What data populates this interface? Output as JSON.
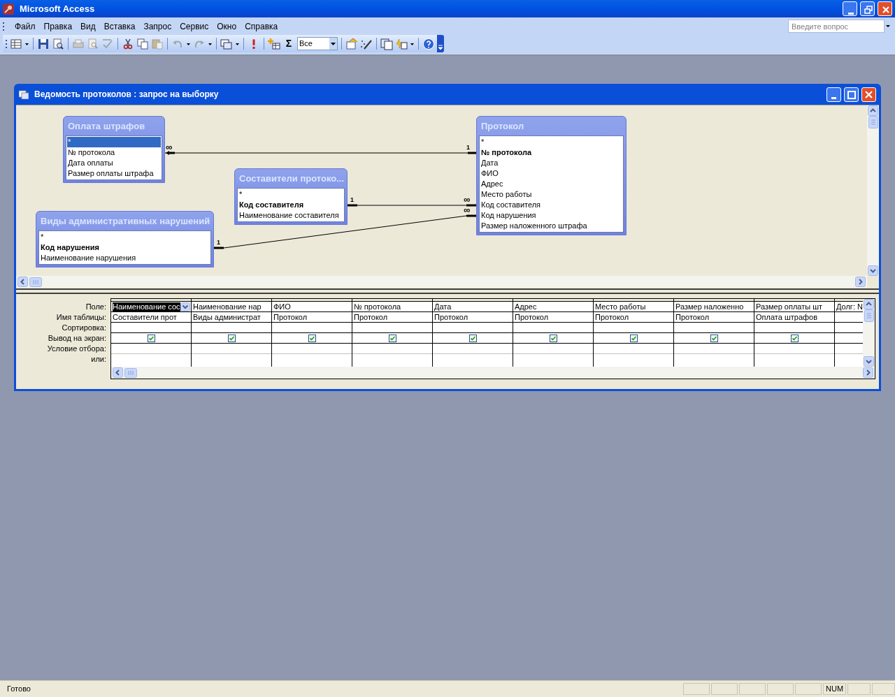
{
  "window": {
    "title": "Microsoft Access"
  },
  "menu": [
    "Файл",
    "Правка",
    "Вид",
    "Вставка",
    "Запрос",
    "Сервис",
    "Окно",
    "Справка"
  ],
  "help_box": {
    "placeholder": "Введите вопрос"
  },
  "toolbar": {
    "sum_label": "Σ",
    "top_values": "Все"
  },
  "query_window": {
    "title": "Ведомость протоколов : запрос на выборку",
    "tables": [
      {
        "title": "Оплата штрафов",
        "fields": [
          {
            "name": "*",
            "key": false,
            "selected": true
          },
          {
            "name": "№ протокола",
            "key": false,
            "selected": false
          },
          {
            "name": "Дата оплаты",
            "key": false,
            "selected": false
          },
          {
            "name": "Размер оплаты штрафа",
            "key": false,
            "selected": false
          }
        ]
      },
      {
        "title": "Составители протоко...",
        "fields": [
          {
            "name": "*",
            "key": false,
            "selected": false
          },
          {
            "name": "Код составителя",
            "key": true,
            "selected": false
          },
          {
            "name": "Наименование составителя",
            "key": false,
            "selected": false
          }
        ]
      },
      {
        "title": "Виды административных нарушений",
        "fields": [
          {
            "name": "*",
            "key": false,
            "selected": false
          },
          {
            "name": "Код нарушения",
            "key": true,
            "selected": false
          },
          {
            "name": "Наименование нарушения",
            "key": false,
            "selected": false
          }
        ]
      },
      {
        "title": "Протокол",
        "fields": [
          {
            "name": "*",
            "key": false,
            "selected": false
          },
          {
            "name": "№ протокола",
            "key": true,
            "selected": false
          },
          {
            "name": "Дата",
            "key": false,
            "selected": false
          },
          {
            "name": "ФИО",
            "key": false,
            "selected": false
          },
          {
            "name": "Адрес",
            "key": false,
            "selected": false
          },
          {
            "name": "Место работы",
            "key": false,
            "selected": false
          },
          {
            "name": "Код составителя",
            "key": false,
            "selected": false
          },
          {
            "name": "Код нарушения",
            "key": false,
            "selected": false
          },
          {
            "name": "Размер наложенного штрафа",
            "key": false,
            "selected": false
          }
        ]
      }
    ],
    "relationships": [
      {
        "one_label": "1",
        "many_label": "∞"
      },
      {
        "one_label": "1",
        "many_label": "∞"
      },
      {
        "one_label": "1",
        "many_label": "∞"
      }
    ],
    "grid": {
      "row_labels": [
        "Поле:",
        "Имя таблицы:",
        "Сортировка:",
        "Вывод на экран:",
        "Условие отбора:",
        "или:"
      ],
      "columns": [
        {
          "field": "Наименование сос",
          "table": "Составители прот",
          "show": true,
          "selected": true
        },
        {
          "field": "Наименование нар",
          "table": "Виды администрат",
          "show": true,
          "selected": false
        },
        {
          "field": "ФИО",
          "table": "Протокол",
          "show": true,
          "selected": false
        },
        {
          "field": "№ протокола",
          "table": "Протокол",
          "show": true,
          "selected": false
        },
        {
          "field": "Дата",
          "table": "Протокол",
          "show": true,
          "selected": false
        },
        {
          "field": "Адрес",
          "table": "Протокол",
          "show": true,
          "selected": false
        },
        {
          "field": "Место работы",
          "table": "Протокол",
          "show": true,
          "selected": false
        },
        {
          "field": "Размер наложенно",
          "table": "Протокол",
          "show": true,
          "selected": false
        },
        {
          "field": "Размер оплаты шт",
          "table": "Оплата штрафов",
          "show": true,
          "selected": false
        },
        {
          "field": "Долг: N",
          "selected": false
        }
      ]
    }
  },
  "status_bar": {
    "text": "Готово",
    "indicator": "NUM"
  }
}
